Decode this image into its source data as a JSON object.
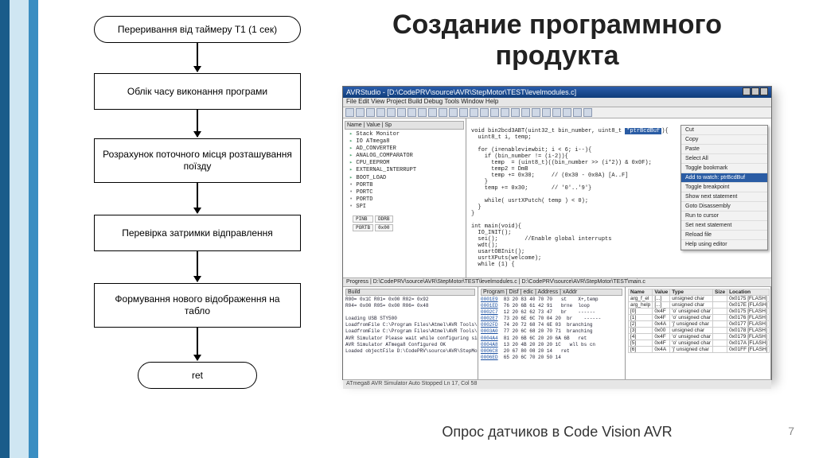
{
  "slide": {
    "title": "Создание программного продукта",
    "caption": "Опрос датчиков в Code Vision AVR",
    "page_number": "7"
  },
  "flow": {
    "n1": "Переривання від таймеру Т1 (1 сек)",
    "n2": "Облік часу виконання програми",
    "n3": "Розрахунок поточного місця розташування поїзду",
    "n4": "Перевірка затримки відправлення",
    "n5": "Формування нового відображення на табло",
    "n6": "ret"
  },
  "shot": {
    "title": "AVRStudio - [D:\\CodePRV\\source\\AVR\\StepMotor\\TEST\\levelmodules.c]",
    "menu": "File  Edit  View  Project  Build  Debug  Tools  Window  Help",
    "tree_header": "Name            | Value | Sp",
    "tree_items": [
      "Stack Monitor",
      "IO ATmega8",
      "AD_CONVERTER",
      "ANALOG_COMPARATOR",
      "CPU_EEPROM",
      "EXTERNAL_INTERRUPT",
      "BOOT_LOAD",
      "PORTB",
      "PORTC",
      "PORTD",
      "SPI"
    ],
    "code_lines": [
      "void bin2bcd3ABT(uint32_t bin_number, uint8_t *ptrBcdBuf){",
      "  uint8_t i, temp;",
      "",
      "  for (i=enableviewbit; i < 6; i--){",
      "    if (bin_number != (i-2)){",
      "      temp  = (uint8_t)((bin_number >> (i*2)) & 0x0F);",
      "      temp2 = DmB",
      "      temp += 0x30;     // (0x30 - 0x0A) [A..F]",
      "    }",
      "    temp += 0x30;       // '0'..'9'}",
      "",
      "    while( usrtXPutch( temp ) < 0);",
      "  }",
      "}",
      "",
      "int main(void){",
      "  IO_INIT();",
      "  sei();        //Enable global interrupts",
      "  wdt();",
      "  usartOBInit();",
      "  usrtXPuts(welcome);",
      "  while (1) {"
    ],
    "ctx_menu": [
      "Cut",
      "Copy",
      "Paste",
      "Select All",
      "Toggle bookmark",
      "Add to watch: ptrBcdBuf",
      "Toggle breakpoint",
      "Show next statement",
      "Goto Disassembly",
      "Run to cursor",
      "Set next statement",
      "Reload file",
      "Help using editor"
    ],
    "midbar": "Progress    |  D:\\CodePRV\\source\\AVR\\StepMotor\\TEST\\levelmodules.c  |  D:\\CodePRV\\source\\AVR\\StepMotor\\TEST\\main.c",
    "p1_header": "Build",
    "p1_text": "R00= 0x1C R01= 0x00 R02= 0x92\nR04= 0x00 R05= 0x00 R06= 0x48\n\nLoading USB STY500\nLoadfromFile C:\\Program Files\\Atmel\\AVR Tools\\Parts\\\nLoadfromFile C:\\Program Files\\Atmel\\AVR Tools\\Parts\\\nAVR Simulator Please wait while configuring simulator...\nAVR Simulator ATmega8 Configured OK\nLoaded objectFile D:\\CodePRV\\source\\AVR\\StepMotor\\TES",
    "p2_header": "Program   | Disf | edic | Address | xAddr",
    "p2_text": "0001E9  83 20 83 40 70 70   st    X+,temp\n0001ED  76 20 6B 61 42 91   brne  loop\n0002C7  12 20 62 62 73 47   br    ------\n0002E7  73 20 6E 6C 70 04 20  br    ------\n0002FD  74 20 72 68 74 6E 03  branching\n0003A0  77 20 6C 68 20 70 71  branching\n0004A4  81 20 6B 6C 20 20 6A 6B   ret\n0004A8  13 20 4B 20 20 20 1C   wll bs cn\n0006C8  20 67 80 08 20 14   ret\n0006ED  65 20 6C 70 20 50 14",
    "p3_header": [
      "Name",
      "Value",
      "Type",
      "Size",
      "Location"
    ],
    "p3_rows": [
      [
        "arg_f_el",
        "[...]",
        "unsigned char",
        "",
        "0x0175 [FLASH]"
      ],
      [
        "arg_help",
        "[...]",
        "unsigned char",
        "",
        "0x017E [FLASH]"
      ],
      [
        "[0]",
        "0x4F",
        "'o' unsigned char",
        "",
        "0x0175 [FLASH]"
      ],
      [
        "[1]",
        "0x4F",
        "'o' unsigned char",
        "",
        "0x0176 [FLASH]"
      ],
      [
        "[2]",
        "0x4A",
        "'j' unsigned char",
        "",
        "0x0177 [FLASH]"
      ],
      [
        "[3]",
        "0x00",
        "unsigned char",
        "",
        "0x0178 [FLASH]"
      ],
      [
        "[4]",
        "0x4F",
        "'o' unsigned char",
        "",
        "0x0179 [FLASH]"
      ],
      [
        "[5]",
        "0x4F",
        "'o' unsigned char",
        "",
        "0x017A [FLASH]"
      ],
      [
        "[6]",
        "0x4A",
        "'j' unsigned char",
        "",
        "0x01FF [FLASH]"
      ]
    ],
    "status": "ATmega8    AVR Simulator    Auto    Stopped        Ln 17, Col 58"
  }
}
